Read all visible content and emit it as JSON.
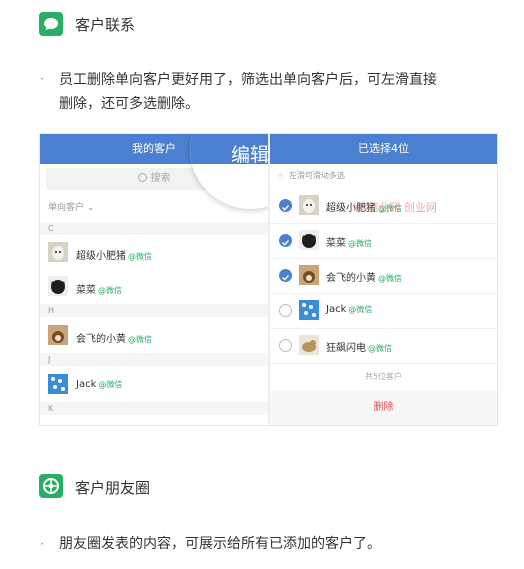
{
  "section1": {
    "title": "客户联系",
    "icon": "chat-bubble-icon",
    "bullet": "·",
    "paragraph_line1": "员工删除单向客户更好用了，筛选出单向客户后，可左滑直接",
    "paragraph_line2": "删除，还可多选删除。"
  },
  "left_panel": {
    "header": "我的客户",
    "search_placeholder": "搜索",
    "filter_label": "单向客户",
    "groups": [
      {
        "letter": "C"
      },
      {
        "letter": "H"
      },
      {
        "letter": "J"
      },
      {
        "letter": "K"
      }
    ],
    "contacts": [
      {
        "name": "超级小肥猪",
        "tag": "@微信"
      },
      {
        "name": "菜菜",
        "tag": "@微信"
      },
      {
        "name": "会飞的小黄",
        "tag": "@微信"
      },
      {
        "name": "Jack",
        "tag": "@微信"
      }
    ],
    "bubble_label": "编辑"
  },
  "right_panel": {
    "header": "已选择4位",
    "hint": "左滑可滑动多选",
    "contacts": [
      {
        "name": "超级小肥猪",
        "tag": "@微信",
        "selected": true
      },
      {
        "name": "菜菜",
        "tag": "@微信",
        "selected": true
      },
      {
        "name": "会飞的小黄",
        "tag": "@微信",
        "selected": true
      },
      {
        "name": "Jack",
        "tag": "@微信",
        "selected": false
      },
      {
        "name": "狂飙闪电",
        "tag": "@微信",
        "selected": false
      }
    ],
    "total": "共5位客户",
    "delete_label": "删除",
    "watermark": "KK创业网 创业网"
  },
  "section2": {
    "title": "客户朋友圈",
    "icon": "moments-icon",
    "bullet": "·",
    "paragraph": "朋友圈发表的内容，可展示给所有已添加的客户了。"
  },
  "colors": {
    "wechat_green": "#2aae67",
    "header_blue": "#4a80cf",
    "delete_red": "#e04b4b"
  }
}
